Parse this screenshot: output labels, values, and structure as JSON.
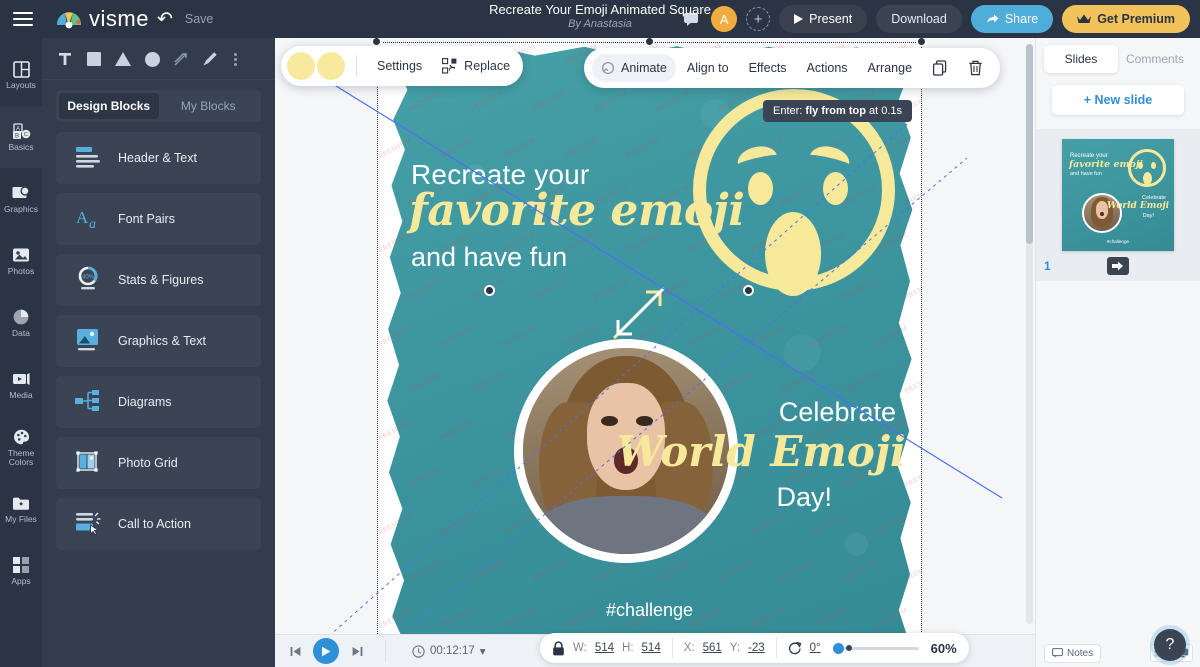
{
  "app": {
    "brand": "visme",
    "save_label": "Save",
    "title": "Recreate Your Emoji Animated Square",
    "byline": "By Anastasia"
  },
  "topbar": {
    "menu_icon": "hamburger-icon",
    "undo_icon": "undo-icon",
    "chat_icon": "comment-icon",
    "avatar_initial": "A",
    "add_user_icon": "add-user-icon",
    "present_label": "Present",
    "download_label": "Download",
    "share_label": "Share",
    "premium_label": "Get Premium"
  },
  "rail": {
    "items": [
      {
        "label": "Layouts",
        "icon": "layouts-icon"
      },
      {
        "label": "Basics",
        "icon": "basics-icon"
      },
      {
        "label": "Graphics",
        "icon": "graphics-icon"
      },
      {
        "label": "Photos",
        "icon": "photos-icon"
      },
      {
        "label": "Data",
        "icon": "data-icon"
      },
      {
        "label": "Media",
        "icon": "media-icon"
      },
      {
        "label": "Theme Colors",
        "icon": "theme-colors-icon"
      },
      {
        "label": "My Files",
        "icon": "my-files-icon"
      },
      {
        "label": "Apps",
        "icon": "apps-icon"
      }
    ]
  },
  "panel": {
    "tools": [
      "text-tool",
      "square-tool",
      "triangle-tool",
      "circle-tool",
      "line-tool",
      "pen-tool",
      "more-tools"
    ],
    "tabs": [
      {
        "label": "Design Blocks",
        "active": true
      },
      {
        "label": "My Blocks",
        "active": false
      }
    ],
    "blocks": [
      {
        "label": "Header & Text",
        "icon": "header-text-icon"
      },
      {
        "label": "Font Pairs",
        "icon": "font-pairs-icon"
      },
      {
        "label": "Stats & Figures",
        "icon": "stats-figures-icon"
      },
      {
        "label": "Graphics & Text",
        "icon": "graphics-text-icon"
      },
      {
        "label": "Diagrams",
        "icon": "diagrams-icon"
      },
      {
        "label": "Photo Grid",
        "icon": "photo-grid-icon"
      },
      {
        "label": "Call to Action",
        "icon": "call-to-action-icon"
      }
    ],
    "stats_badge": "40%"
  },
  "element_toolbar": {
    "swatch1": "#f7e99d",
    "swatch2": "#f7e99d",
    "settings_label": "Settings",
    "replace_label": "Replace",
    "replace_icon": "swap-icon"
  },
  "action_toolbar": {
    "items": [
      {
        "label": "Animate",
        "active": true,
        "icon": "animate-icon"
      },
      {
        "label": "Align to",
        "active": false
      },
      {
        "label": "Effects",
        "active": false
      },
      {
        "label": "Actions",
        "active": false
      },
      {
        "label": "Arrange",
        "active": false
      }
    ],
    "duplicate_icon": "duplicate-icon",
    "delete_icon": "trash-icon"
  },
  "tooltip": {
    "prefix": "Enter: ",
    "effect": "fly from top",
    "suffix": " at 0.1s"
  },
  "slide": {
    "line1": "Recreate your",
    "line2": "favorite emoji",
    "line3": "and have fun",
    "line4": "Celebrate",
    "line5": "World Emoji",
    "line6": "Day!",
    "hashtag": "#challenge",
    "bg_color": "#3f9aa3",
    "accent_color": "#f6e99a",
    "watermark": "PREMIUM"
  },
  "bottombar": {
    "prev_icon": "skip-back-icon",
    "play_icon": "play-icon",
    "next_icon": "skip-forward-icon",
    "clock_icon": "clock-icon",
    "duration": "00:12:17",
    "chevron_icon": "chevron-down-icon"
  },
  "props": {
    "lock_icon": "lock-icon",
    "w_label": "W:",
    "w_value": "514",
    "h_label": "H:",
    "h_value": "514",
    "x_label": "X:",
    "x_value": "561",
    "y_label": "Y:",
    "y_value": "-23",
    "rotate_icon": "rotate-icon",
    "rotation": "0°",
    "zoom": "60%"
  },
  "help": {
    "label": "?"
  },
  "right_panel": {
    "tabs": [
      {
        "label": "Slides",
        "active": true
      },
      {
        "label": "Comments",
        "active": false
      }
    ],
    "new_slide_label": "+ New slide",
    "slide_number": "1",
    "transition_icon": "transition-icon",
    "notes_label": "Notes",
    "notes_icon": "notes-icon",
    "grid_view_icon": "grid-view-icon",
    "single_view_icon": "single-view-icon"
  }
}
